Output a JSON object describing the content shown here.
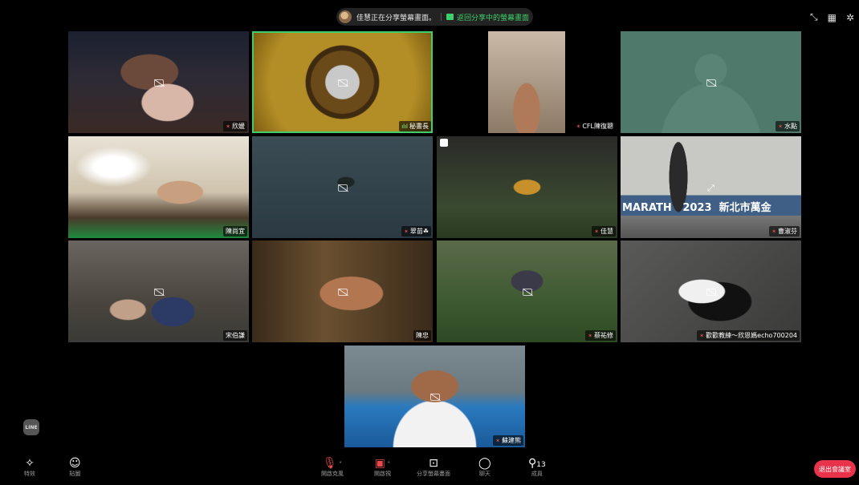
{
  "banner": {
    "sharing_text": "佳慧正在分享螢幕畫面。",
    "return_label": "返回分享中的螢幕畫面"
  },
  "top_right": {
    "icons": [
      "collapse-icon",
      "grid-view-icon",
      "settings-icon"
    ]
  },
  "participants": [
    {
      "name": "欣媛",
      "muted": true
    },
    {
      "name": "秘書長",
      "muted": false
    },
    {
      "name": "CFL陳復聰",
      "muted": true
    },
    {
      "name": "水點",
      "muted": true
    },
    {
      "name": "陳尚宜",
      "muted": false
    },
    {
      "name": "翠苗☘",
      "muted": true
    },
    {
      "name": "佳慧",
      "muted": true
    },
    {
      "name": "曹淑芬",
      "muted": true
    },
    {
      "name": "宋伯謙",
      "muted": false
    },
    {
      "name": "陳忠",
      "muted": false
    },
    {
      "name": "蔡祐修",
      "muted": true
    },
    {
      "name": "歡歡教練～欣恩媽echo700204",
      "muted": true
    },
    {
      "name": "蘇建熊",
      "muted": true
    }
  ],
  "overlays": {
    "banner_sign": "MARATH   2023  新北市萬金"
  },
  "toolbar": {
    "effects_label": "特效",
    "stickers_label": "貼圖",
    "mic_label": "開啟克風",
    "video_label": "開啟視",
    "share_label": "分享螢幕畫面",
    "chat_label": "聊天",
    "members_label": "成員",
    "members_count": "13",
    "leave_label": "退出會議室"
  },
  "logo_text": "LINE",
  "colors": {
    "accent_green": "#3ecf6a",
    "leave_red": "#e8334a",
    "mic_muted": "#e84a4a"
  }
}
